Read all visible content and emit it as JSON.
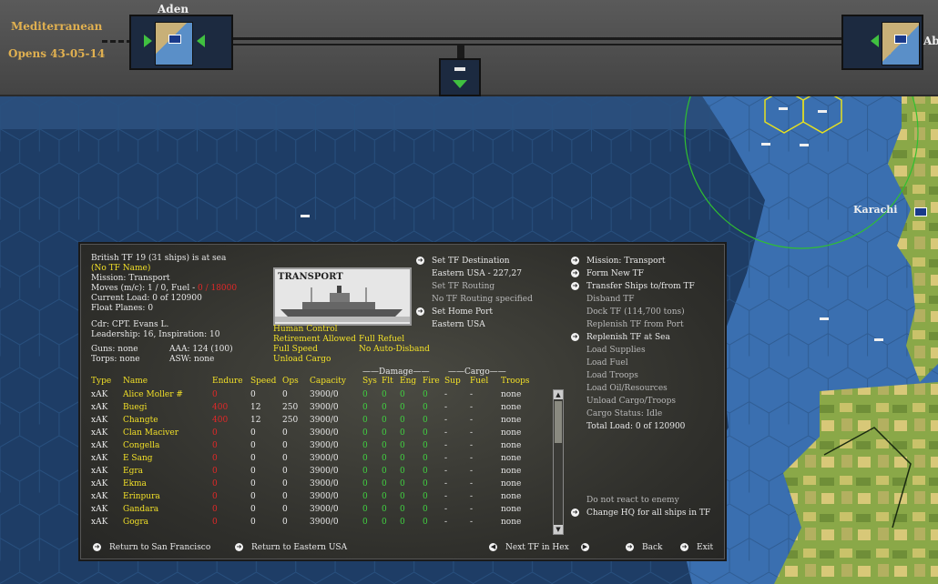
{
  "topbar": {
    "sea_name": "Mediterranean",
    "opens": "Opens 43-05-14",
    "port_left": "Aden",
    "port_right_partial": "Ab"
  },
  "map": {
    "city_label": "Karachi"
  },
  "panel": {
    "info": {
      "tf_line": "British TF 19 (31 ships) is at sea",
      "tf_name": "(No TF Name)",
      "mission": "Mission: Transport",
      "moves_prefix": "Moves (m/c): 1 / 0, Fuel - ",
      "moves_fuel": "0 / 18000",
      "current_load": "Current Load: 0 of 120900",
      "float_planes": "Float Planes: 0",
      "cdr": "Cdr: CPT. Evans L.",
      "leadership": "Leadership: 16, Inspiration: 10",
      "guns": "Guns: none",
      "aaa": "AAA: 124 (100)",
      "torps": "Torps: none",
      "asw": "ASW: none"
    },
    "ship_image_label": "TRANSPORT",
    "options": {
      "human_control": "Human Control",
      "retirement": "Retirement Allowed",
      "full_speed": "Full Speed",
      "unload_cargo": "Unload Cargo",
      "full_refuel": "Full Refuel",
      "no_auto_disband": "No Auto-Disband"
    },
    "destination": {
      "set_dest": "Set TF Destination",
      "dest_value": "Eastern USA - 227,27",
      "set_routing": "Set TF Routing",
      "routing_value": "No TF Routing specified",
      "set_home": "Set Home Port",
      "home_value": "Eastern USA"
    },
    "commands": [
      {
        "label": "Mission: Transport",
        "active": true
      },
      {
        "label": "Form New TF",
        "active": true
      },
      {
        "label": "Transfer Ships to/from TF",
        "active": true
      },
      {
        "label": "Disband TF",
        "active": false
      },
      {
        "label": "Dock TF (114,700 tons)",
        "active": false
      },
      {
        "label": "Replenish TF from Port",
        "active": false
      },
      {
        "label": "Replenish TF at Sea",
        "active": true
      },
      {
        "label": "Load Supplies",
        "active": false
      },
      {
        "label": "Load Fuel",
        "active": false
      },
      {
        "label": "Load Troops",
        "active": false
      },
      {
        "label": "Load Oil/Resources",
        "active": false
      },
      {
        "label": "Unload Cargo/Troops",
        "active": false
      },
      {
        "label": "Cargo Status: Idle",
        "active": false
      },
      {
        "label": "Total Load: 0 of 120900",
        "active": false,
        "white": true
      }
    ],
    "bottom_right": {
      "no_react": "Do not react to enemy",
      "change_hq": "Change HQ for all ships in TF"
    },
    "table": {
      "group_damage": "Damage",
      "group_cargo": "Cargo",
      "headers": [
        "Type",
        "Name",
        "Endure",
        "Speed",
        "Ops",
        "Capacity",
        "Sys",
        "Flt",
        "Eng",
        "Fire",
        "Sup",
        "Fuel",
        "Troops"
      ],
      "rows": [
        [
          "xAK",
          "Alice Moller #",
          "0",
          "0",
          "0",
          "3900/0",
          "0",
          "0",
          "0",
          "0",
          "-",
          "-",
          "none"
        ],
        [
          "xAK",
          "Buegi",
          "400",
          "12",
          "250",
          "3900/0",
          "0",
          "0",
          "0",
          "0",
          "-",
          "-",
          "none"
        ],
        [
          "xAK",
          "Changte",
          "400",
          "12",
          "250",
          "3900/0",
          "0",
          "0",
          "0",
          "0",
          "-",
          "-",
          "none"
        ],
        [
          "xAK",
          "Clan Maciver",
          "0",
          "0",
          "0",
          "3900/0",
          "0",
          "0",
          "0",
          "0",
          "-",
          "-",
          "none"
        ],
        [
          "xAK",
          "Congella",
          "0",
          "0",
          "0",
          "3900/0",
          "0",
          "0",
          "0",
          "0",
          "-",
          "-",
          "none"
        ],
        [
          "xAK",
          "E Sang",
          "0",
          "0",
          "0",
          "3900/0",
          "0",
          "0",
          "0",
          "0",
          "-",
          "-",
          "none"
        ],
        [
          "xAK",
          "Egra",
          "0",
          "0",
          "0",
          "3900/0",
          "0",
          "0",
          "0",
          "0",
          "-",
          "-",
          "none"
        ],
        [
          "xAK",
          "Ekma",
          "0",
          "0",
          "0",
          "3900/0",
          "0",
          "0",
          "0",
          "0",
          "-",
          "-",
          "none"
        ],
        [
          "xAK",
          "Erinpura",
          "0",
          "0",
          "0",
          "3900/0",
          "0",
          "0",
          "0",
          "0",
          "-",
          "-",
          "none"
        ],
        [
          "xAK",
          "Gandara",
          "0",
          "0",
          "0",
          "3900/0",
          "0",
          "0",
          "0",
          "0",
          "-",
          "-",
          "none"
        ],
        [
          "xAK",
          "Gogra",
          "0",
          "0",
          "0",
          "3900/0",
          "0",
          "0",
          "0",
          "0",
          "-",
          "-",
          "none"
        ]
      ]
    },
    "footer": {
      "return_sf": "Return to San Francisco",
      "return_east": "Return to Eastern USA",
      "next_tf": "Next TF in Hex",
      "back": "Back",
      "exit": "Exit"
    }
  },
  "colors": {
    "ocean_deep": "#1e3d66",
    "ocean_shallow": "#3a6fb0",
    "highlight_text": "#f2e028",
    "warning_text": "#e02828",
    "damage_ok": "#40d040",
    "range_circle": "#30c030"
  }
}
